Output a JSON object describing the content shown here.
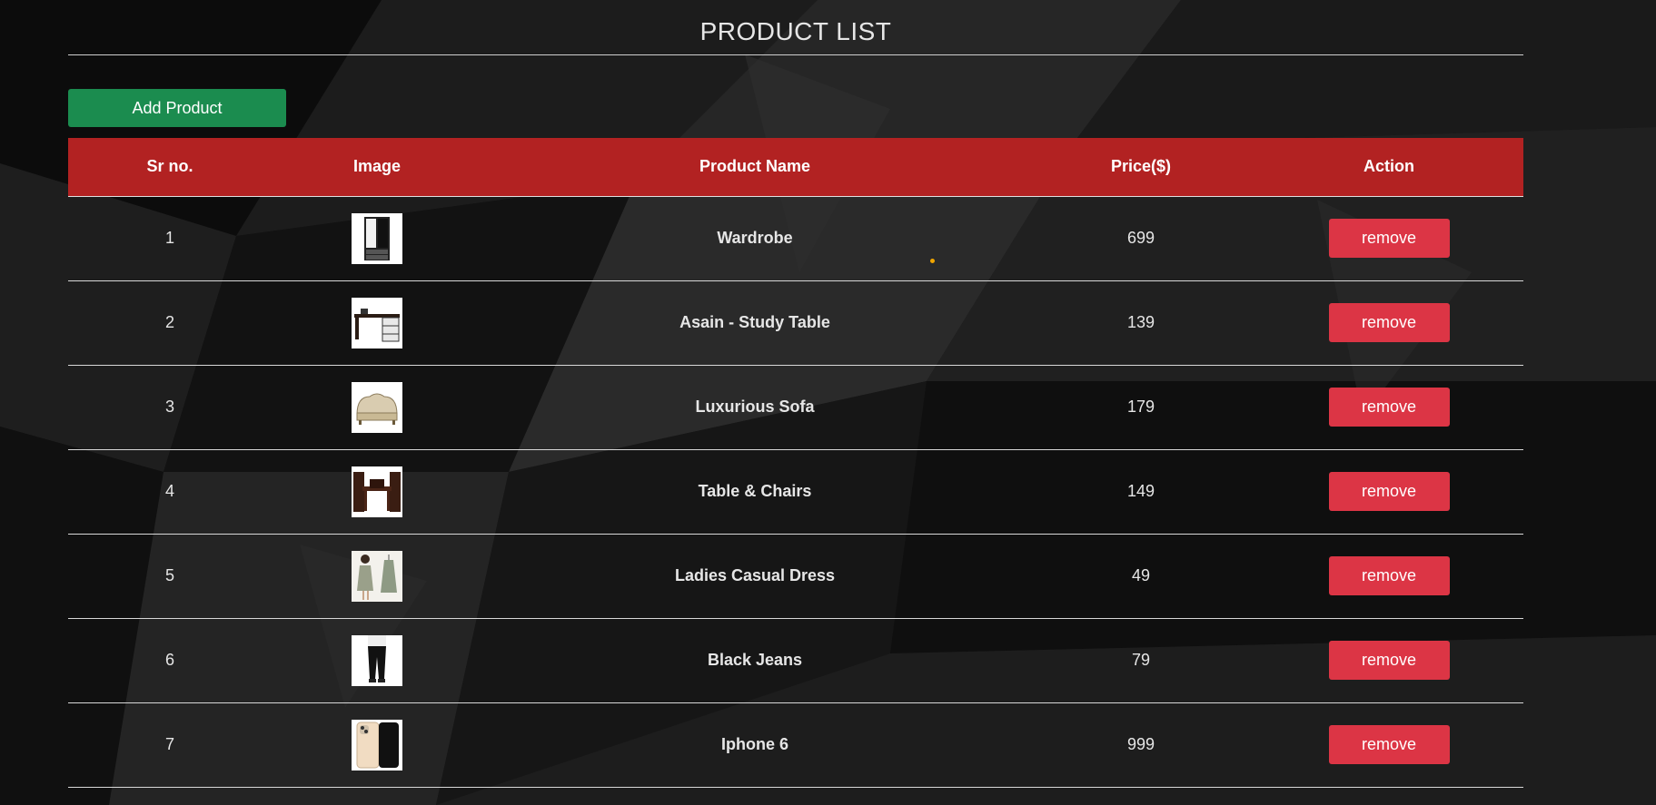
{
  "page": {
    "title": "PRODUCT LIST"
  },
  "toolbar": {
    "add_label": "Add Product"
  },
  "table": {
    "headers": {
      "sr": "Sr no.",
      "image": "Image",
      "name": "Product Name",
      "price": "Price($)",
      "action": "Action"
    },
    "rows": [
      {
        "sr": "1",
        "image": "wardrobe-thumbnail",
        "name": "Wardrobe",
        "price": "699",
        "action": "remove"
      },
      {
        "sr": "2",
        "image": "study-table-thumbnail",
        "name": "Asain - Study Table",
        "price": "139",
        "action": "remove"
      },
      {
        "sr": "3",
        "image": "sofa-thumbnail",
        "name": "Luxurious Sofa",
        "price": "179",
        "action": "remove"
      },
      {
        "sr": "4",
        "image": "table-chairs-thumbnail",
        "name": "Table & Chairs",
        "price": "149",
        "action": "remove"
      },
      {
        "sr": "5",
        "image": "dress-thumbnail",
        "name": "Ladies Casual Dress",
        "price": "49",
        "action": "remove"
      },
      {
        "sr": "6",
        "image": "jeans-thumbnail",
        "name": "Black Jeans",
        "price": "79",
        "action": "remove"
      },
      {
        "sr": "7",
        "image": "iphone-thumbnail",
        "name": "Iphone 6",
        "price": "999",
        "action": "remove"
      }
    ]
  },
  "colors": {
    "header_bg": "#b22222",
    "add_button": "#1b8c4f",
    "remove_button": "#dc3545",
    "background": "#111111"
  }
}
